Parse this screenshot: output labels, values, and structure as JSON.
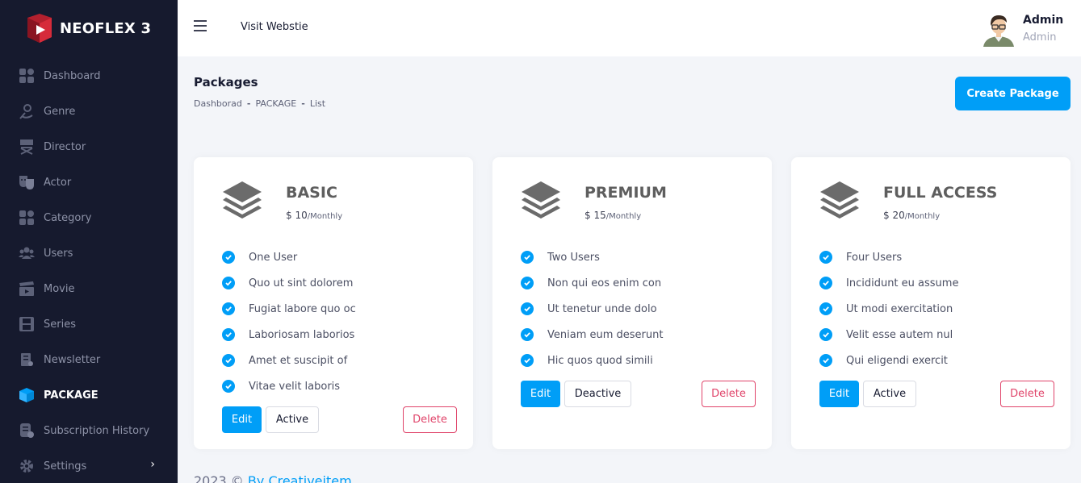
{
  "brand": {
    "name": "NEOFLEX 3"
  },
  "sidebar": {
    "items": [
      {
        "label": "Dashboard",
        "icon": "dashboard-icon"
      },
      {
        "label": "Genre",
        "icon": "genre-icon"
      },
      {
        "label": "Director",
        "icon": "director-chair-icon"
      },
      {
        "label": "Actor",
        "icon": "theater-masks-icon"
      },
      {
        "label": "Category",
        "icon": "category-icon"
      },
      {
        "label": "Users",
        "icon": "users-icon"
      },
      {
        "label": "Movie",
        "icon": "clapperboard-icon"
      },
      {
        "label": "Series",
        "icon": "film-strip-icon"
      },
      {
        "label": "Newsletter",
        "icon": "newsletter-icon"
      },
      {
        "label": "PACKAGE",
        "icon": "package-cube-icon",
        "active": true
      },
      {
        "label": "Subscription History",
        "icon": "subscription-history-icon"
      },
      {
        "label": "Settings",
        "icon": "gear-icon"
      }
    ],
    "settings_arrow": "›"
  },
  "header": {
    "visit_label": "Visit Webstie",
    "user_name": "Admin",
    "user_role": "Admin"
  },
  "page": {
    "title": "Packages",
    "breadcrumb": [
      "Dashborad",
      "PACKAGE",
      "List"
    ],
    "breadcrumb_sep": "-",
    "create_label": "Create Package"
  },
  "packages": [
    {
      "title": "BASIC",
      "price": "$ 10",
      "period": "/Monthly",
      "features": [
        "One User",
        "Quo ut sint dolorem",
        "Fugiat labore quo oc",
        "Laboriosam laborios",
        "Amet et suscipit of",
        "Vitae velit laboris"
      ],
      "edit_label": "Edit",
      "status_label": "Active",
      "delete_label": "Delete"
    },
    {
      "title": "PREMIUM",
      "price": "$ 15",
      "period": "/Monthly",
      "features": [
        "Two Users",
        "Non qui eos enim con",
        "Ut tenetur unde dolo",
        "Veniam eum deserunt",
        "Hic quos quod simili"
      ],
      "edit_label": "Edit",
      "status_label": "Deactive",
      "delete_label": "Delete"
    },
    {
      "title": "FULL ACCESS",
      "price": "$ 20",
      "period": "/Monthly",
      "features": [
        "Four Users",
        "Incididunt eu assume",
        "Ut modi exercitation",
        "Velit esse autem nul",
        "Qui eligendi exercit"
      ],
      "edit_label": "Edit",
      "status_label": "Active",
      "delete_label": "Delete"
    }
  ],
  "footer": {
    "year": "2023 ©",
    "link": "By Creativeitem"
  },
  "colors": {
    "sidebar_bg": "#161a2e",
    "primary": "#009ef7",
    "danger": "#e0446a",
    "page_bg": "#f3f5f9"
  }
}
